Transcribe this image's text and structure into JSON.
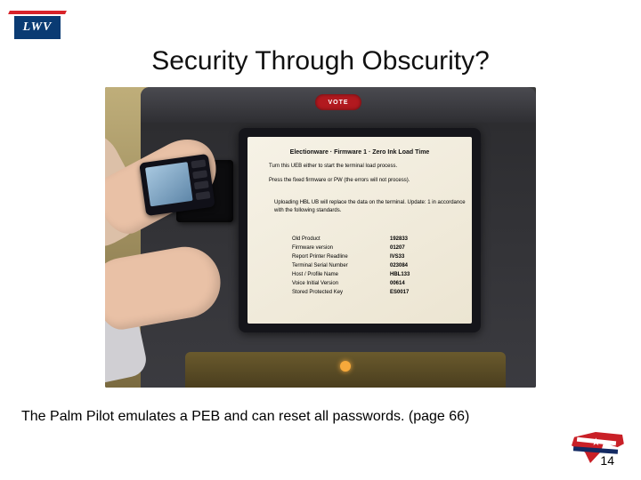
{
  "logo": {
    "text": "LWV"
  },
  "title": "Security Through Obscurity?",
  "photo": {
    "vote_button": "VOTE",
    "screen": {
      "heading": "Electionware · Firmware 1 · Zero Ink Load Time",
      "line_a": "Turn this UEB either to start the terminal load process.",
      "line_b": "Press the fixed firmware or PW (the errors will not process).",
      "block": "Uploading HBL UB will replace the data on the terminal.\nUpdate: 1 in accordance with the following standards.",
      "rows": [
        {
          "label": "Old Product",
          "value": "192833"
        },
        {
          "label": "Firmware version",
          "value": "01207"
        },
        {
          "label": "Report Printer Readline",
          "value": "IVS33"
        },
        {
          "label": "Terminal Serial Number",
          "value": "023084"
        },
        {
          "label": "Host / Profile Name",
          "value": "HBL133"
        },
        {
          "label": "Voice Initial Version",
          "value": "00614"
        },
        {
          "label": "Stored Protected Key",
          "value": "ES0017"
        }
      ]
    }
  },
  "caption": "The Palm Pilot emulates a PEB and can reset all passwords. (page 66)",
  "page_number": "14"
}
